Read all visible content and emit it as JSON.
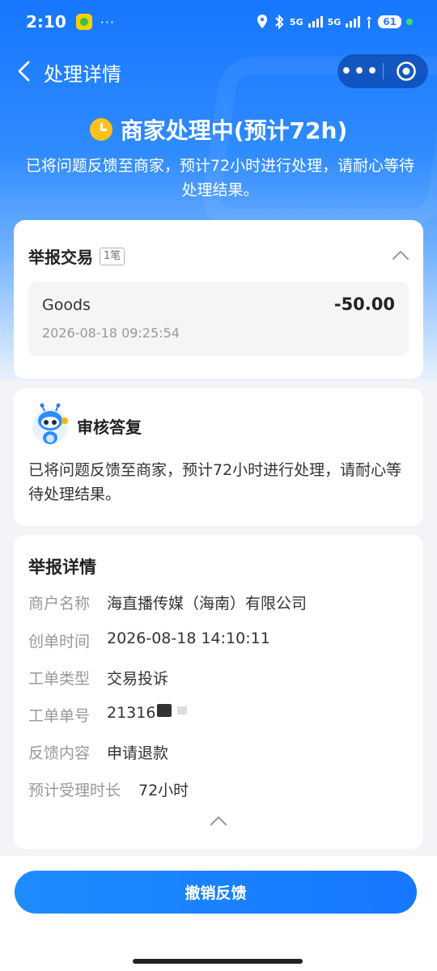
{
  "status_bar": {
    "time": "2:10",
    "dots": "···",
    "net1": "5G",
    "net2": "5G",
    "battery": "61"
  },
  "nav": {
    "title": "处理详情",
    "more": "•••"
  },
  "hero": {
    "title": "商家处理中(预计72h)",
    "description": "已将问题反馈至商家，预计72小时进行处理，请耐心等待处理结果。"
  },
  "report_transaction": {
    "title": "举报交易",
    "count_badge": "1笔",
    "item": {
      "name": "Goods",
      "amount": "-50.00",
      "time": "2026-08-18 09:25:54"
    }
  },
  "review_reply": {
    "title": "审核答复",
    "body": "已将问题反馈至商家，预计72小时进行处理，请耐心等待处理结果。"
  },
  "report_details": {
    "title": "举报详情",
    "rows": [
      {
        "label": "商户名称",
        "value": "海直播传媒（海南）有限公司"
      },
      {
        "label": "创单时间",
        "value": "2026-08-18 14:10:11"
      },
      {
        "label": "工单类型",
        "value": "交易投诉"
      },
      {
        "label": "工单单号",
        "value": "21316"
      },
      {
        "label": "反馈内容",
        "value": "申请退款"
      },
      {
        "label": "预计受理时长",
        "value": "72小时"
      }
    ]
  },
  "actions": {
    "revoke_label": "撤销反馈"
  },
  "colors": {
    "primary": "#1677ff",
    "clock": "#ffc21a"
  }
}
